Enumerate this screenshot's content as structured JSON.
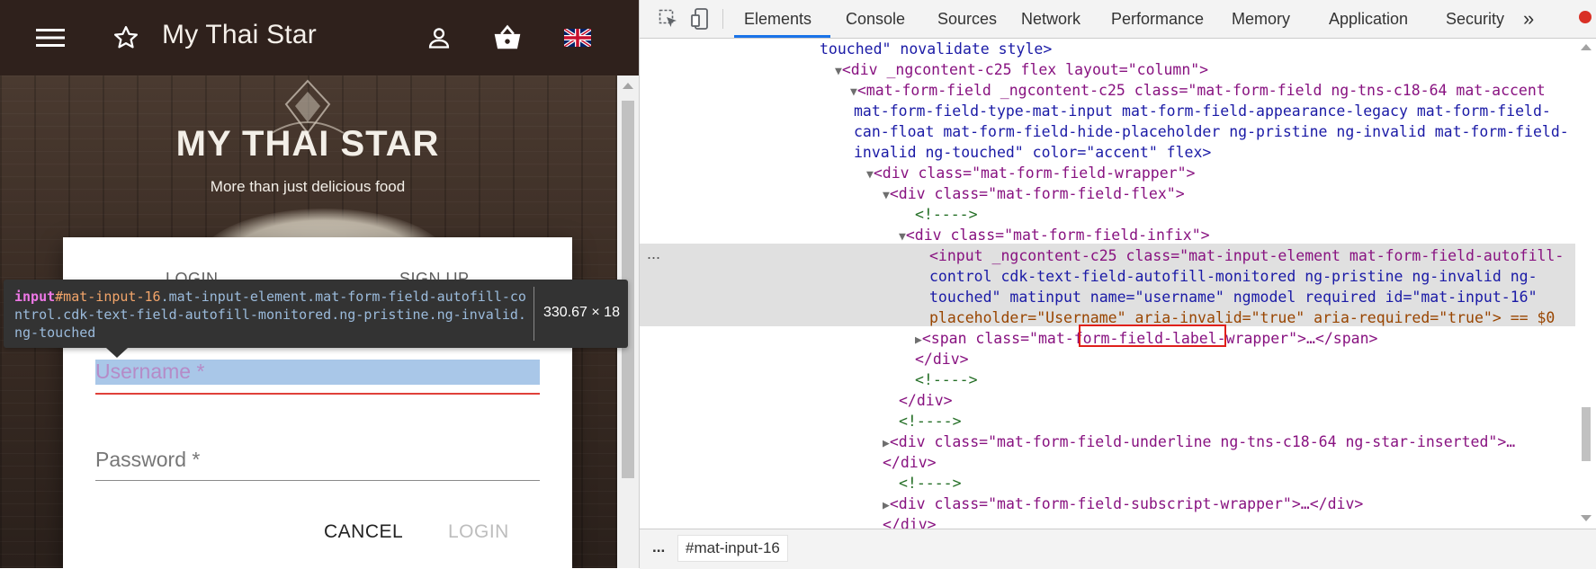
{
  "app": {
    "title": "My Thai Star",
    "brand_title": "MY THAI STAR",
    "brand_subtitle": "More than just delicious food"
  },
  "dialog": {
    "tabs": [
      "LOGIN",
      "SIGN UP"
    ],
    "username_placeholder": "Username *",
    "password_placeholder": "Password *",
    "cancel_label": "CANCEL",
    "login_label": "LOGIN"
  },
  "tooltip": {
    "tag": "input",
    "id": "#mat-input-16",
    "classes": ".mat-input-element.mat-form-field-autofill-control.cdk-text-field-autofill-monitored.ng-pristine.ng-invalid.ng-touched",
    "dims": "330.67 × 18"
  },
  "devtools": {
    "tabs": [
      "Elements",
      "Console",
      "Sources",
      "Network",
      "Performance",
      "Memory",
      "Application",
      "Security"
    ],
    "active_tab": "Elements",
    "more": "»",
    "breadcrumb": "#mat-input-16",
    "ellipsis": "...",
    "dots": "...",
    "code_lines": [
      "touched\" novalidate style>",
      "<div _ngcontent-c25 flex layout=\"column\">",
      "<mat-form-field _ngcontent-c25 class=\"mat-form-field ng-tns-c18-64 mat-accent",
      "mat-form-field-type-mat-input mat-form-field-appearance-legacy mat-form-field-",
      "can-float mat-form-field-hide-placeholder ng-pristine ng-invalid mat-form-field-",
      "invalid ng-touched\" color=\"accent\" flex>",
      "<div class=\"mat-form-field-wrapper\">",
      "<div class=\"mat-form-field-flex\">",
      "<!---->",
      "<div class=\"mat-form-field-infix\">",
      "<input _ngcontent-c25 class=\"mat-input-element mat-form-field-autofill-",
      "control cdk-text-field-autofill-monitored ng-pristine ng-invalid ng-",
      "touched\" matinput name=\"username\" ngmodel required id=\"mat-input-16\"",
      "placeholder=\"Username\" aria-invalid=\"true\" aria-required=\"true\"> == $0",
      "<span class=\"mat-form-field-label-wrapper\">…</span>",
      "</div>",
      "<!---->",
      "</div>",
      "<!---->",
      "<div class=\"mat-form-field-underline ng-tns-c18-64 ng-star-inserted\">…",
      "</div>",
      "<!---->",
      "<div class=\"mat-form-field-subscript-wrapper\">…</div>",
      "</div>"
    ]
  }
}
